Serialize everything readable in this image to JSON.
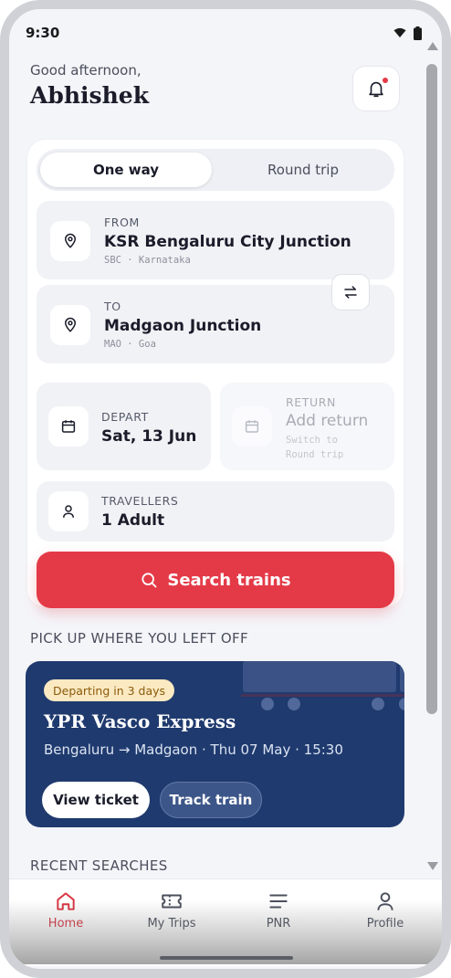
{
  "status": {
    "time": "9:30"
  },
  "header": {
    "greeting": "Good afternoon,",
    "name": "Abhishek"
  },
  "tabs": {
    "one_way": "One way",
    "round_trip": "Round trip"
  },
  "from": {
    "label": "FROM",
    "station": "KSR Bengaluru City Junction",
    "code": "SBC · Karnataka"
  },
  "to": {
    "label": "TO",
    "station": "Madgaon Junction",
    "code": "MAO · Goa"
  },
  "depart": {
    "label": "DEPART",
    "value": "Sat, 13 Jun"
  },
  "return": {
    "label": "RETURN",
    "value": "Add return",
    "hint": "Switch to\nRound trip"
  },
  "travellers": {
    "label": "TRAVELLERS",
    "value": "1 Adult"
  },
  "search_button": "Search trains",
  "resume": {
    "heading": "PICK UP WHERE YOU LEFT OFF",
    "badge": "Departing in 3 days",
    "title": "YPR Vasco Express",
    "route": "Bengaluru → Madgaon · Thu 07 May · 15:30",
    "view_ticket": "View ticket",
    "track_train": "Track train"
  },
  "recent": {
    "heading": "RECENT SEARCHES"
  },
  "nav": [
    {
      "label": "Home",
      "icon": "home-icon",
      "active": true
    },
    {
      "label": "My Trips",
      "icon": "ticket-icon",
      "active": false
    },
    {
      "label": "PNR",
      "icon": "list-icon",
      "active": false
    },
    {
      "label": "Profile",
      "icon": "person-icon",
      "active": false
    }
  ],
  "colors": {
    "accent": "#e43a47",
    "navy": "#1f3a6e",
    "badge_bg": "#fbe9c2"
  }
}
